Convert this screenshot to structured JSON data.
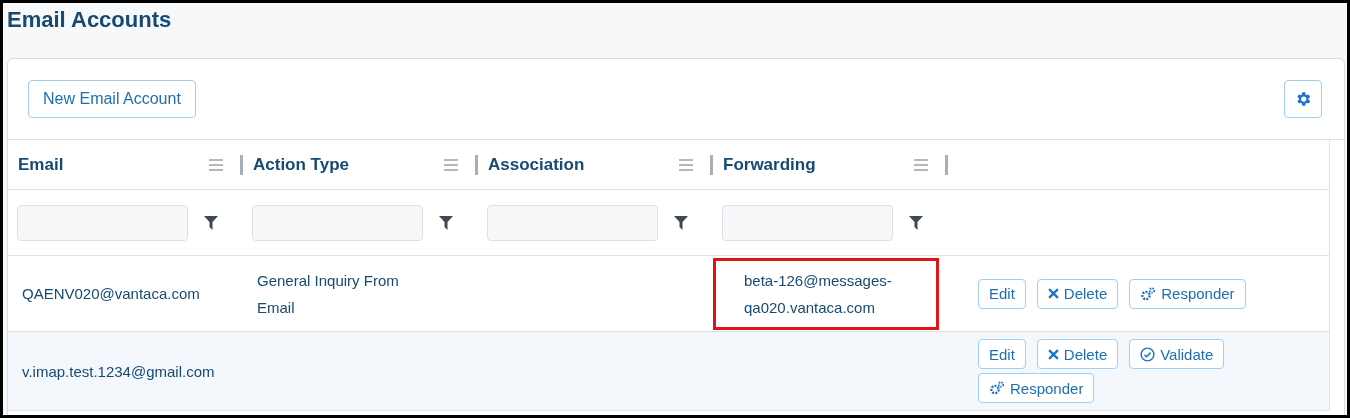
{
  "page": {
    "title": "Email Accounts"
  },
  "toolbar": {
    "new_button": "New Email Account"
  },
  "table": {
    "columns": [
      "Email",
      "Action Type",
      "Association",
      "Forwarding"
    ],
    "rows": [
      {
        "email": "QAENV020@vantaca.com",
        "action_type": "General Inquiry From Email",
        "forwarding": "beta-126@messages-qa020.vantaca.com",
        "highlighted": true,
        "actions": [
          {
            "kind": "edit",
            "label": "Edit"
          },
          {
            "kind": "delete",
            "label": "Delete"
          },
          {
            "kind": "responder",
            "label": "Responder"
          }
        ]
      },
      {
        "email": "v.imap.test.1234@gmail.com",
        "actions": [
          {
            "kind": "edit",
            "label": "Edit"
          },
          {
            "kind": "delete",
            "label": "Delete"
          },
          {
            "kind": "validate",
            "label": "Validate"
          },
          {
            "kind": "responder",
            "label": "Responder"
          }
        ]
      }
    ]
  }
}
